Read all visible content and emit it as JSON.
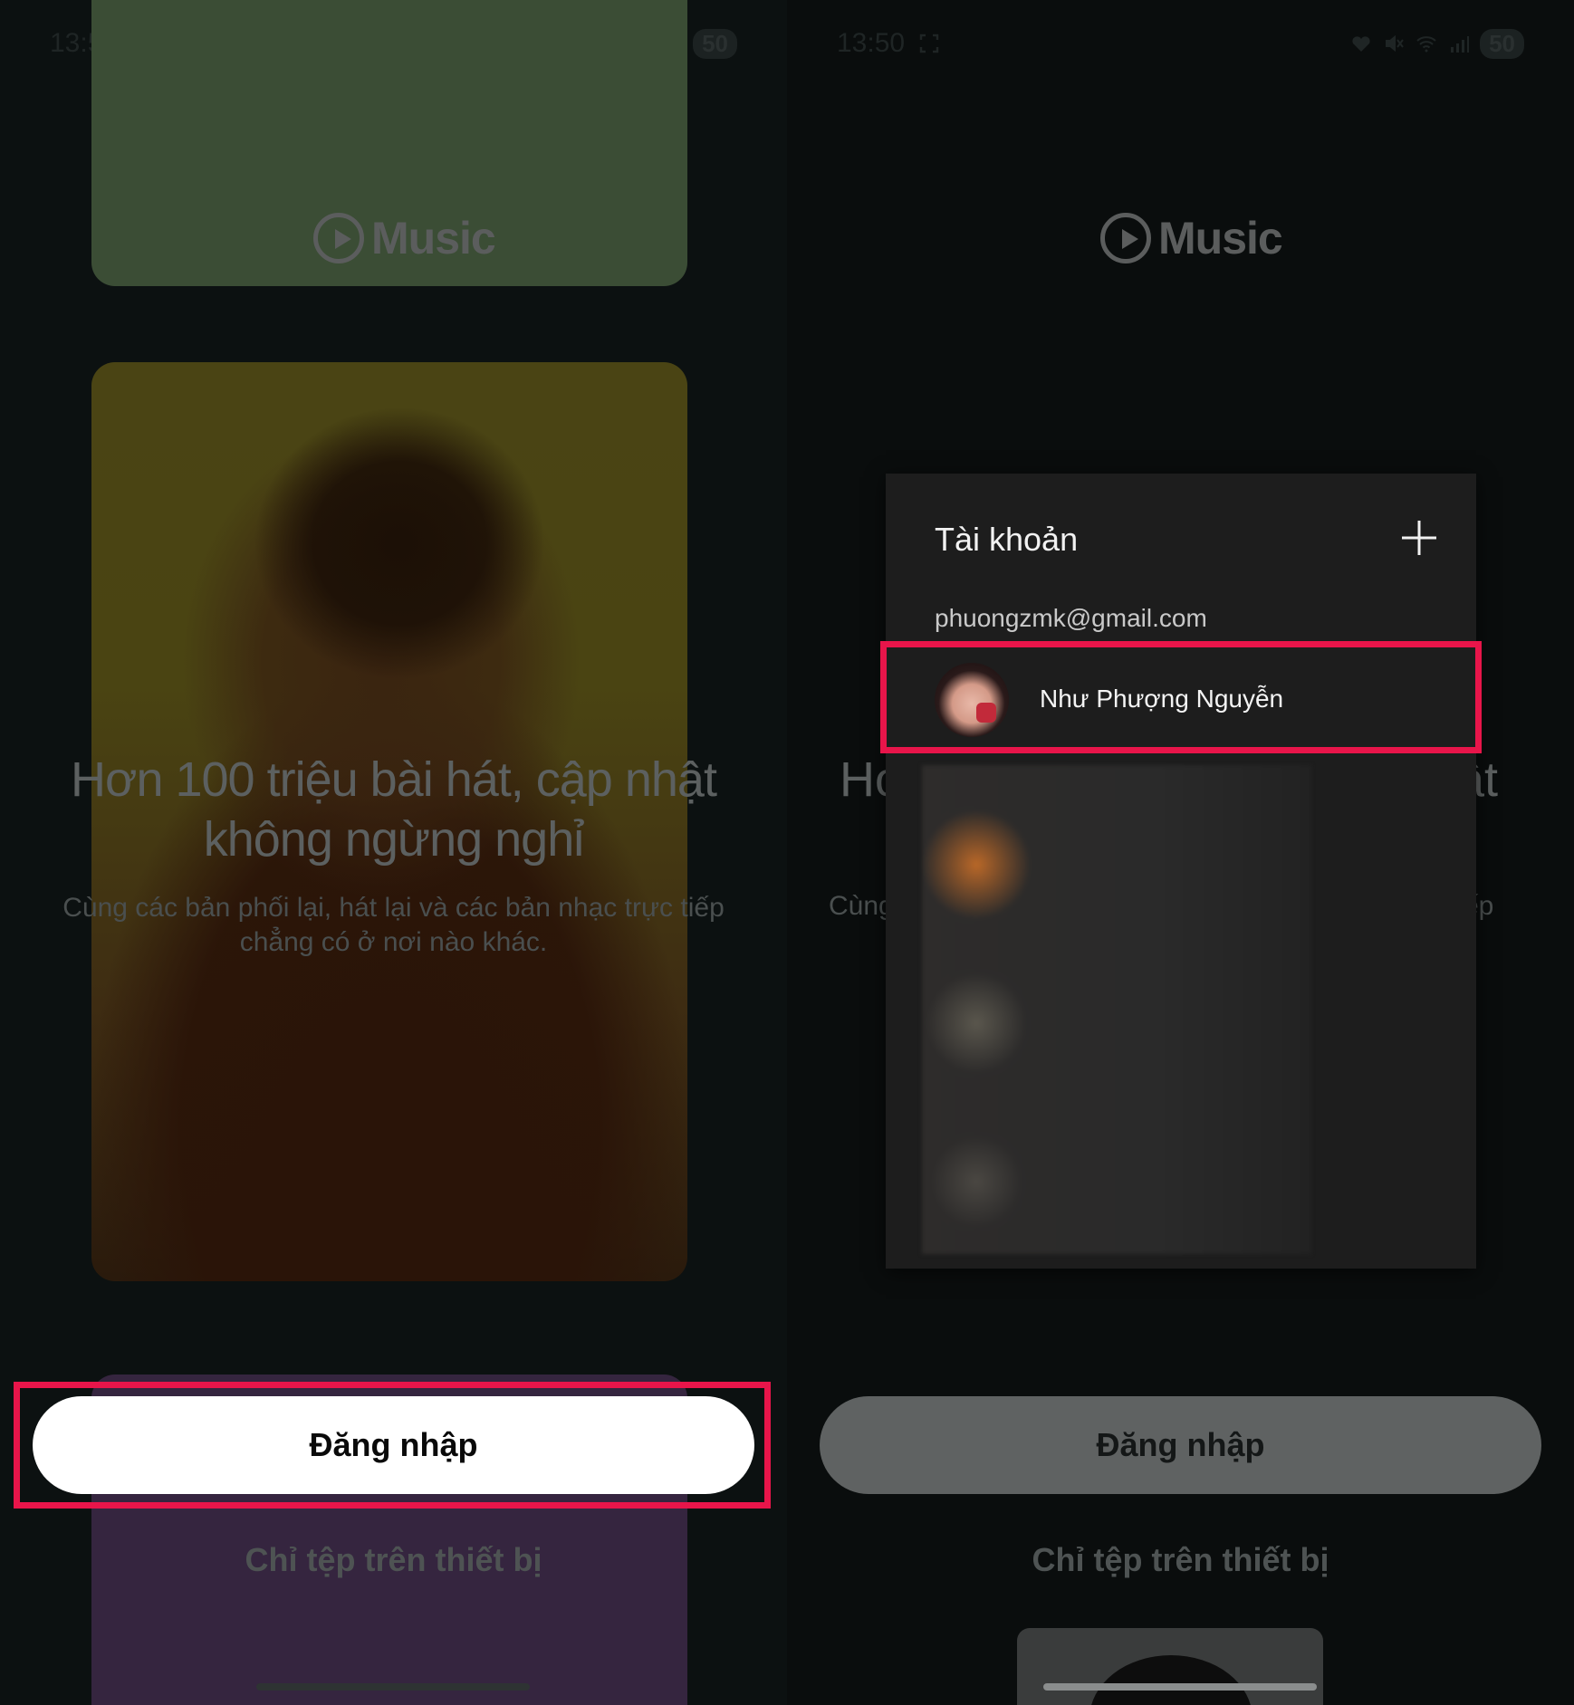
{
  "status_bar": {
    "time": "13:50",
    "battery": "50",
    "icons": [
      "heart-icon",
      "mute-icon",
      "wifi-icon",
      "signal-icon"
    ]
  },
  "brand": {
    "name": "Music"
  },
  "onboarding": {
    "headline_line1": "Hơn 100 triệu bài hát, cập nhật",
    "headline_line2": "không ngừng nghỉ",
    "subline_line1": "Cùng các bản phối lại, hát lại và các bản nhạc trực tiếp",
    "subline_line2": "chẳng có ở nơi nào khác.",
    "login_label": "Đăng nhập",
    "device_files_label": "Chỉ tệp trên thiết bị"
  },
  "right_partial": {
    "head_left": "Hơ",
    "head_right": "ật",
    "sub_left": "Cùng",
    "sub_right": "tiếp"
  },
  "account_panel": {
    "title": "Tài khoản",
    "email": "phuongzmk@gmail.com",
    "account_name": "Như Phượng Nguyễn"
  },
  "colors": {
    "highlight": "#e8154a",
    "panel_bg": "#1d1d1d"
  }
}
